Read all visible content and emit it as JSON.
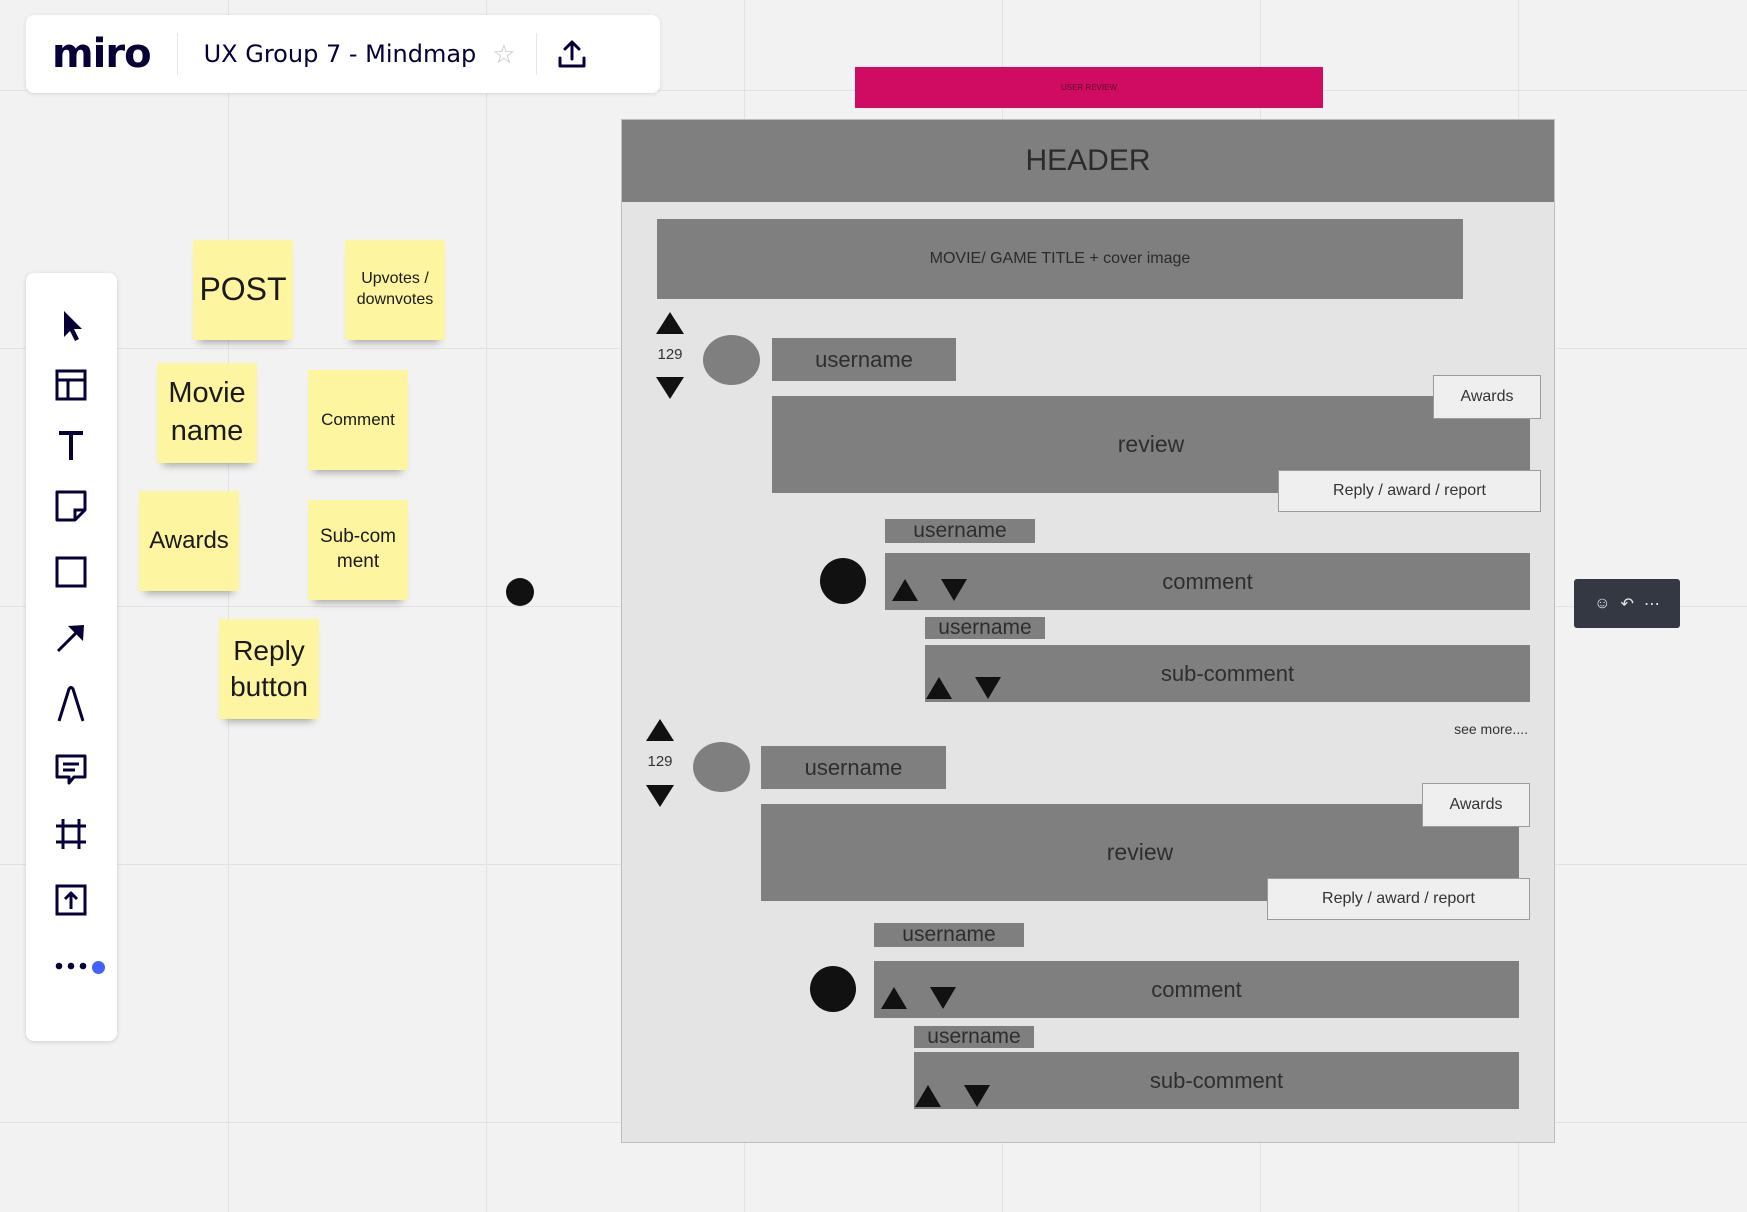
{
  "app": {
    "logo": "miro",
    "board_title": "UX Group 7 - Mindmap",
    "star_icon": "star-icon",
    "upload_icon": "upload-icon"
  },
  "toolbar": {
    "tools": [
      "select-cursor-icon",
      "templates-icon",
      "text-icon",
      "sticky-note-icon",
      "shape-icon",
      "connection-line-icon",
      "pen-icon",
      "comment-icon",
      "frame-icon",
      "upload-icon",
      "more-icon"
    ]
  },
  "stickies": {
    "post": "POST",
    "upvotes": "Upvotes / downvotes",
    "movie_name": "Movie name",
    "comment": "Comment",
    "awards": "Awards",
    "sub_comment": "Sub-comment",
    "reply_button": "Reply button"
  },
  "wireframe": {
    "banner": "USER REVIEW",
    "header": "HEADER",
    "title_box": "MOVIE/ GAME TITLE + cover image",
    "reviews": [
      {
        "votes": "129",
        "username": "username",
        "awards": "Awards",
        "review": "review",
        "actions": "Reply / award / report",
        "comment_username": "username",
        "comment": "comment",
        "subcomment_username": "username",
        "subcomment": "sub-comment"
      },
      {
        "votes": "129",
        "username": "username",
        "awards": "Awards",
        "review": "review",
        "actions": "Reply / award / report",
        "comment_username": "username",
        "comment": "comment",
        "subcomment_username": "username",
        "subcomment": "sub-comment"
      }
    ],
    "see_more": "see more....",
    "banner_color": "#d00b62"
  },
  "context_menu": {
    "icons": [
      "reaction-icon",
      "reply-icon",
      "more-options-icon"
    ]
  }
}
